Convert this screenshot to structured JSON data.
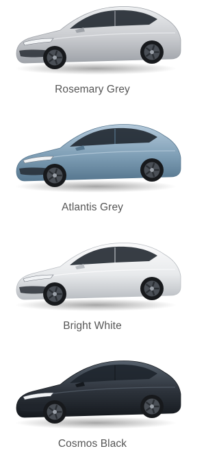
{
  "colors": [
    {
      "name": "Rosemary Grey",
      "body": "#c9cbcf",
      "body_light": "#eceef0",
      "body_dark": "#9ea2a8"
    },
    {
      "name": "Atlantis Grey",
      "body": "#7f9fb6",
      "body_light": "#b5cadb",
      "body_dark": "#56768e"
    },
    {
      "name": "Bright White",
      "body": "#e8eaec",
      "body_light": "#fbfbfc",
      "body_dark": "#b9bdc2"
    },
    {
      "name": "Cosmos Black",
      "body": "#2c323a",
      "body_light": "#56606c",
      "body_dark": "#15191e"
    }
  ]
}
